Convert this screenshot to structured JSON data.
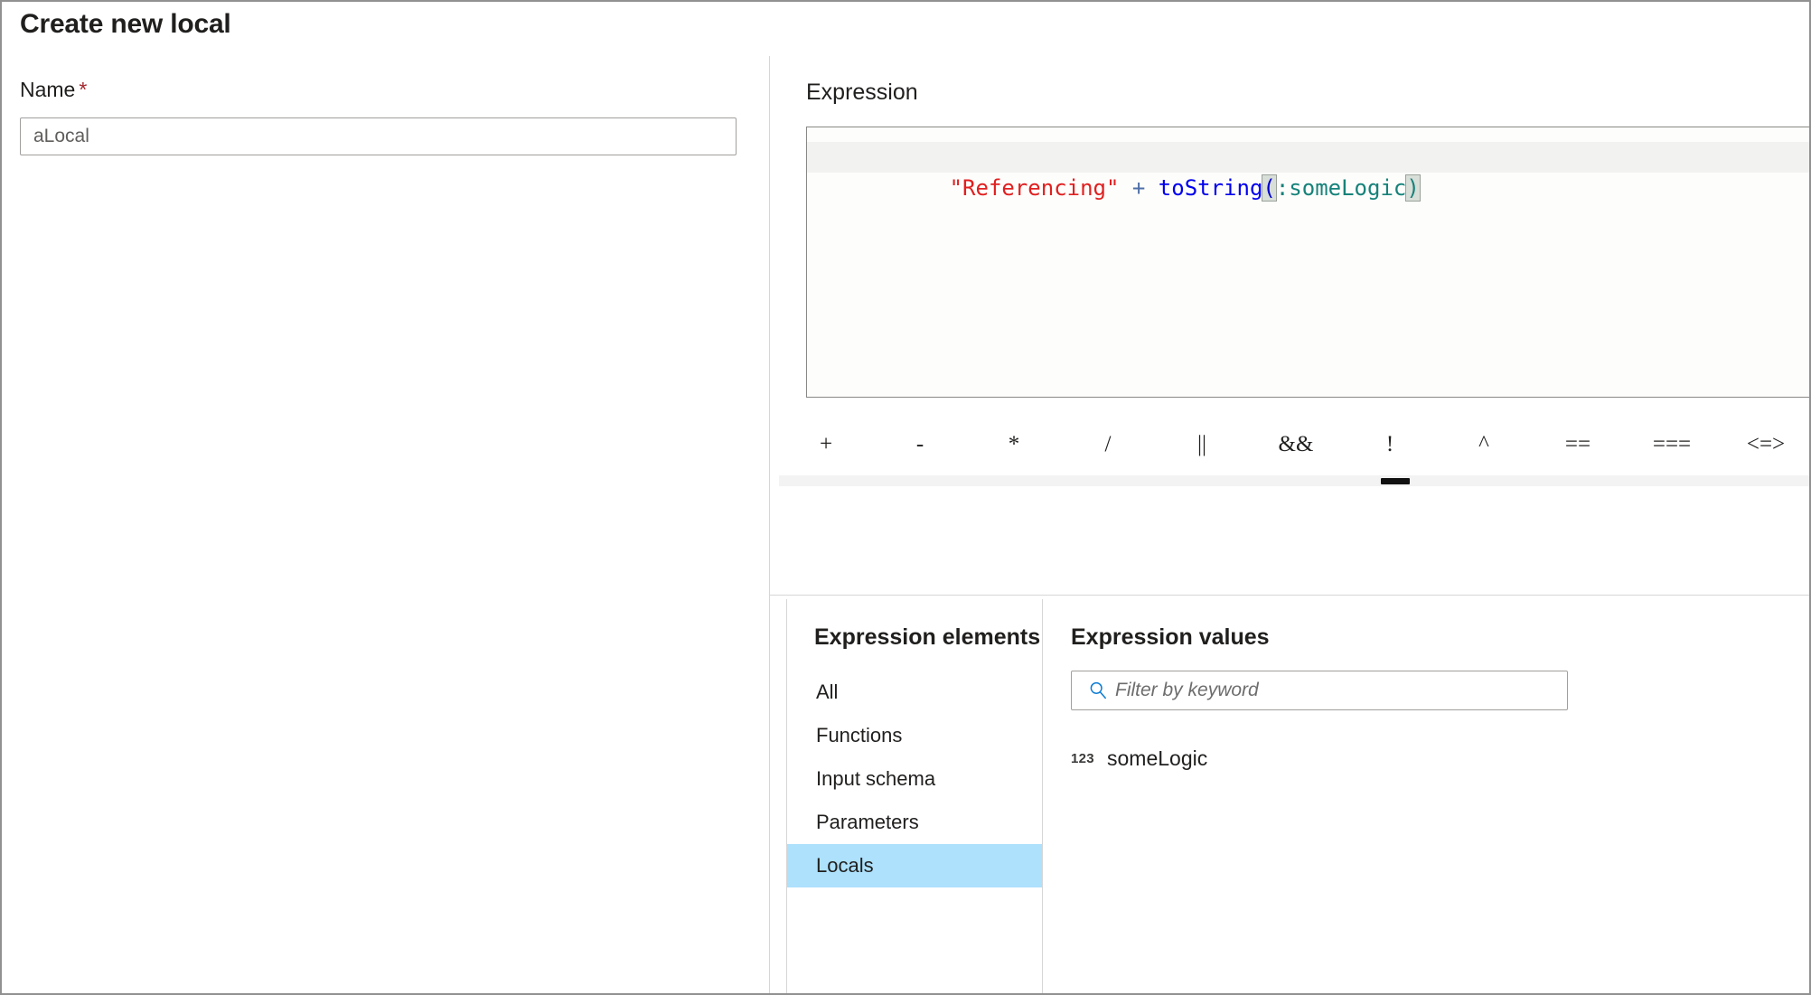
{
  "dialog": {
    "title": "Create new local"
  },
  "name_field": {
    "label": "Name",
    "required_marker": "*",
    "value": "aLocal",
    "placeholder": "aLocal"
  },
  "expression": {
    "label": "Expression",
    "code_tokens": [
      {
        "text": "\"Referencing\"",
        "kind": "string"
      },
      {
        "text": " ",
        "kind": "plain"
      },
      {
        "text": "+",
        "kind": "operator"
      },
      {
        "text": " ",
        "kind": "plain"
      },
      {
        "text": "toString",
        "kind": "function"
      },
      {
        "text": "(",
        "kind": "bracket-open"
      },
      {
        "text": ":someLogic",
        "kind": "reference"
      },
      {
        "text": ")",
        "kind": "bracket-close"
      }
    ],
    "code_plain": "\"Referencing\" + toString(:someLogic)",
    "parts": {
      "string_literal": "\"Referencing\"",
      "plus": "+",
      "function_name": "toString",
      "open_paren": "(",
      "reference": ":someLogic",
      "close_paren": ")"
    }
  },
  "operators": [
    {
      "label": "+",
      "name": "plus"
    },
    {
      "label": "-",
      "name": "minus"
    },
    {
      "label": "*",
      "name": "multiply"
    },
    {
      "label": "/",
      "name": "divide"
    },
    {
      "label": "||",
      "name": "logical-or"
    },
    {
      "label": "&&",
      "name": "logical-and"
    },
    {
      "label": "!",
      "name": "logical-not"
    },
    {
      "label": "^",
      "name": "caret"
    },
    {
      "label": "==",
      "name": "equals"
    },
    {
      "label": "===",
      "name": "strict-equals"
    },
    {
      "label": "<=>",
      "name": "spaceship"
    }
  ],
  "expression_elements": {
    "heading": "Expression elements",
    "items": [
      {
        "label": "All",
        "selected": false
      },
      {
        "label": "Functions",
        "selected": false
      },
      {
        "label": "Input schema",
        "selected": false
      },
      {
        "label": "Parameters",
        "selected": false
      },
      {
        "label": "Locals",
        "selected": true
      }
    ]
  },
  "expression_values": {
    "heading": "Expression values",
    "filter": {
      "placeholder": "Filter by keyword",
      "value": "",
      "icon": "search-icon"
    },
    "items": [
      {
        "type_icon": "123",
        "label": "someLogic"
      }
    ]
  },
  "colors": {
    "accent_blue": "#0078d4",
    "selection_blue": "#ade1fc",
    "required_red": "#a4262c",
    "code_string_red": "#e02020",
    "code_function_blue": "#0000ee",
    "code_reference_teal": "#16827a",
    "border_gray": "#a19f9d",
    "divider_gray": "#d6d6d6"
  }
}
